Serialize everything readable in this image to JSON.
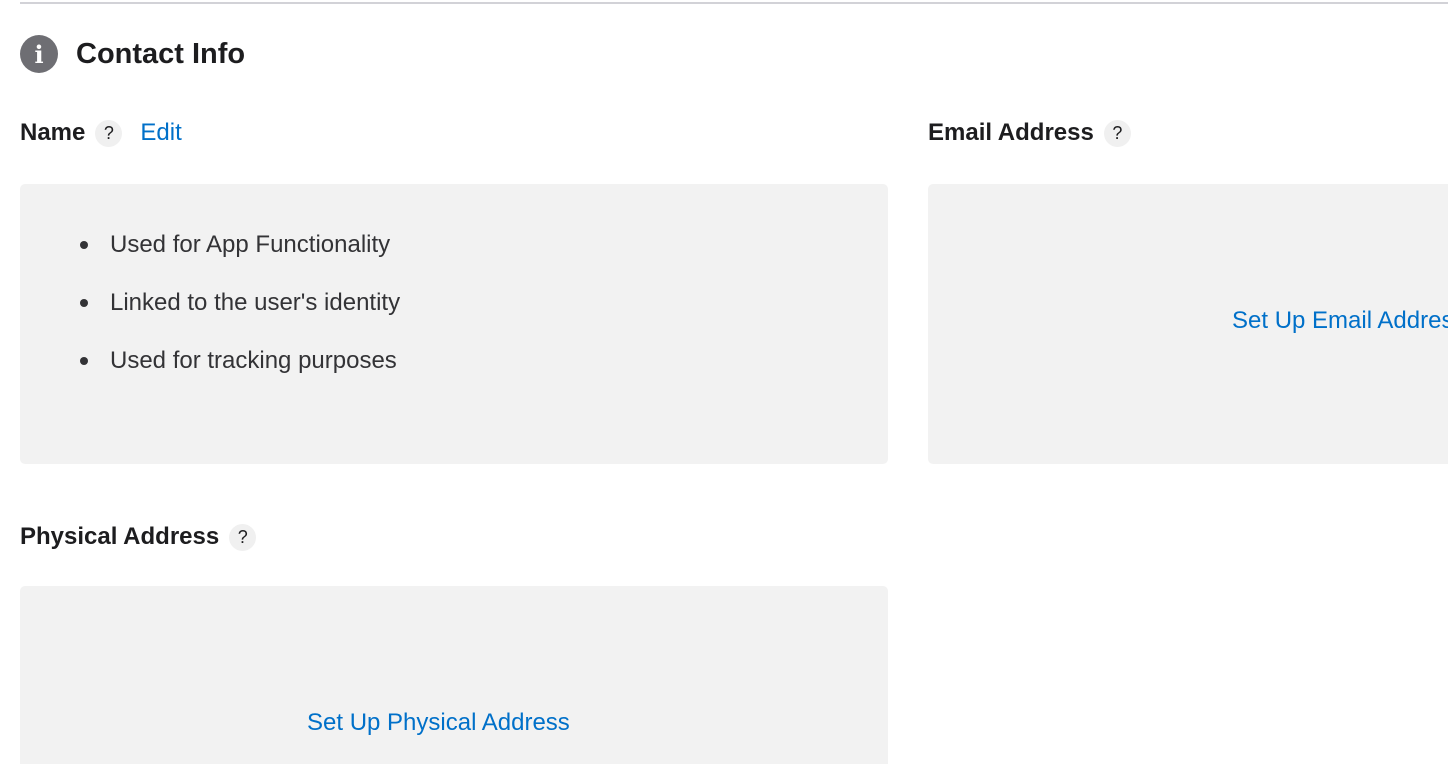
{
  "section": {
    "title": "Contact Info",
    "icon": "info-icon"
  },
  "name_field": {
    "label": "Name",
    "help": "?",
    "edit_label": "Edit",
    "bullets": [
      "Used for App Functionality",
      "Linked to the user's identity",
      "Used for tracking purposes"
    ]
  },
  "email_field": {
    "label": "Email Address",
    "help": "?",
    "setup_label": "Set Up Email Address"
  },
  "physical_field": {
    "label": "Physical Address",
    "help": "?",
    "setup_label": "Set Up Physical Address"
  },
  "colors": {
    "link": "#0070c9",
    "card_bg": "#f2f2f2",
    "icon_bg": "#6e6e73"
  }
}
